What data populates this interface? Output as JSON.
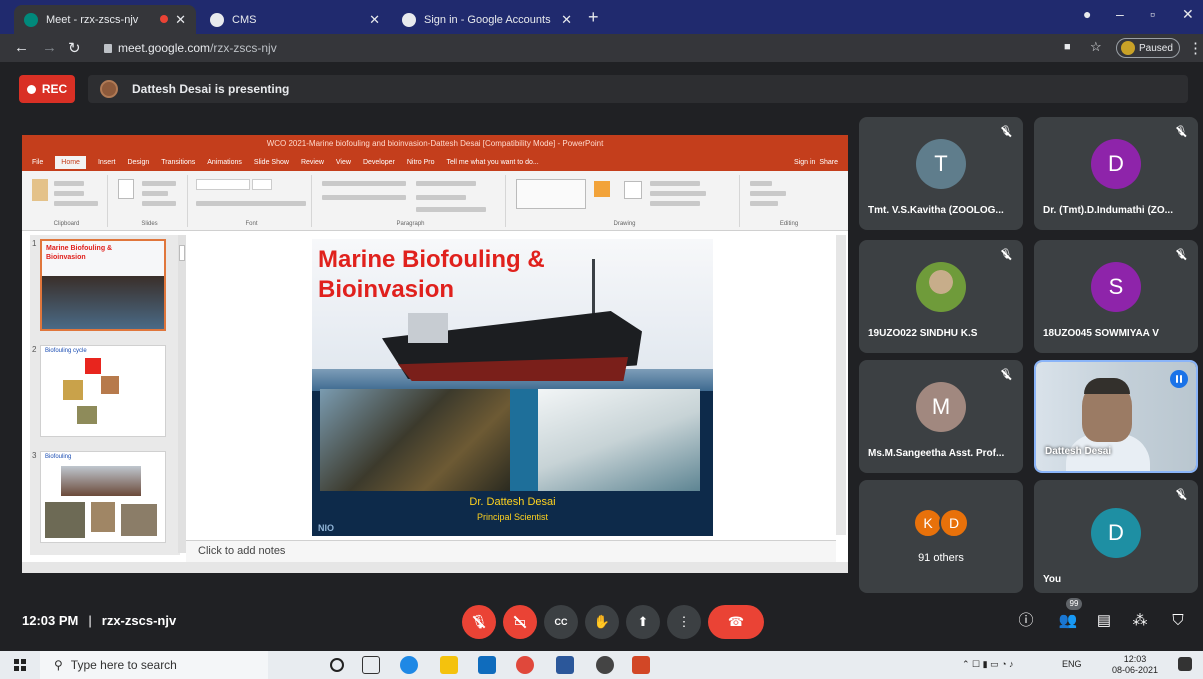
{
  "browser": {
    "tabs": [
      {
        "title": "Meet - rzx-zscs-njv",
        "active": true
      },
      {
        "title": "CMS",
        "active": false
      },
      {
        "title": "Sign in - Google Accounts",
        "active": false
      }
    ],
    "url_host": "meet.google.com",
    "url_path": "/rzx-zscs-njv",
    "profile_status": "Paused"
  },
  "meet": {
    "rec_label": "REC",
    "presenting_text": "Dattesh Desai is presenting",
    "time": "12:03 PM",
    "separator": "|",
    "meeting_code": "rzx-zscs-njv",
    "people_badge": "99"
  },
  "presentation": {
    "window_title": "WCO 2021-Marine biofouling and bioinvasion-Dattesh Desai [Compatibility Mode] - PowerPoint",
    "menu": [
      "File",
      "Home",
      "Insert",
      "Design",
      "Transitions",
      "Animations",
      "Slide Show",
      "Review",
      "View",
      "Developer",
      "Nitro Pro",
      "Tell me what you want to do..."
    ],
    "active_menu": "Home",
    "sign_in": "Sign in",
    "share": "Share",
    "ribbon_groups": [
      "Clipboard",
      "Slides",
      "Font",
      "Paragraph",
      "Drawing",
      "Editing"
    ],
    "thumbnails": [
      {
        "num": "1",
        "title": "Marine Biofouling & Bioinvasion"
      },
      {
        "num": "2",
        "title": "Biofouling cycle"
      },
      {
        "num": "3",
        "title": "Biofouling"
      }
    ],
    "slide": {
      "title_line1": "Marine Biofouling &",
      "title_line2": "Bioinvasion",
      "author": "Dr. Dattesh Desai",
      "role": "Principal Scientist",
      "logo": "NIO"
    },
    "notes_placeholder": "Click to add notes"
  },
  "participants": [
    {
      "name": "Tmt. V.S.Kavitha (ZOOLOG...",
      "initial": "T",
      "color": "#5f7d8c",
      "muted": true
    },
    {
      "name": "Dr. (Tmt).D.Indumathi (ZO...",
      "initial": "D",
      "color": "#8e24aa",
      "muted": true
    },
    {
      "name": "19UZO022 SINDHU K.S",
      "initial": "",
      "color": "#6f9b3a",
      "muted": true
    },
    {
      "name": "18UZO045 SOWMIYAA V",
      "initial": "S",
      "color": "#8e24aa",
      "muted": true
    },
    {
      "name": "Ms.M.Sangeetha Asst. Prof...",
      "initial": "M",
      "color": "#a1887f",
      "muted": true
    },
    {
      "name": "Dattesh Desai",
      "initial": "",
      "color": "",
      "speaking": true
    },
    {
      "others_count": "91 others",
      "initials": [
        "K",
        "D"
      ]
    },
    {
      "name": "You",
      "initial": "D",
      "color": "#1e8fa3",
      "muted": true
    }
  ],
  "taskbar": {
    "search_placeholder": "Type here to search",
    "lang": "ENG",
    "clock_time": "12:03",
    "clock_date": "08-06-2021"
  },
  "colors": {
    "meet_bg": "#202124",
    "tile_bg": "#3c4043",
    "danger": "#ea4335",
    "ppt_accent": "#c43e1c"
  }
}
